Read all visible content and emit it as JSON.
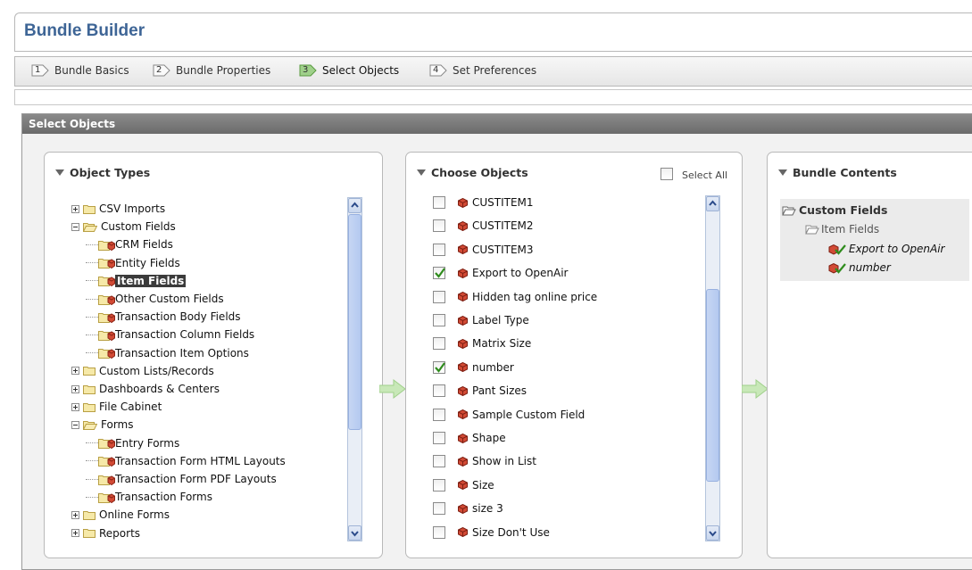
{
  "app": {
    "title": "Bundle Builder"
  },
  "steps": [
    {
      "num": "1",
      "label": "Bundle Basics",
      "active": false
    },
    {
      "num": "2",
      "label": "Bundle Properties",
      "active": false
    },
    {
      "num": "3",
      "label": "Select Objects",
      "active": true
    },
    {
      "num": "4",
      "label": "Set Preferences",
      "active": false
    }
  ],
  "section": {
    "title": "Select Objects"
  },
  "object_types": {
    "title": "Object Types",
    "tree": [
      {
        "label": "CSV Imports",
        "expander": "plus"
      },
      {
        "label": "Custom Fields",
        "expander": "minus"
      },
      {
        "label": "CRM Fields"
      },
      {
        "label": "Entity Fields"
      },
      {
        "label": "Item Fields",
        "selected": true
      },
      {
        "label": "Other Custom Fields"
      },
      {
        "label": "Transaction Body Fields"
      },
      {
        "label": "Transaction Column Fields"
      },
      {
        "label": "Transaction Item Options"
      },
      {
        "label": "Custom Lists/Records",
        "expander": "plus"
      },
      {
        "label": "Dashboards & Centers",
        "expander": "plus"
      },
      {
        "label": "File Cabinet",
        "expander": "plus"
      },
      {
        "label": "Forms",
        "expander": "minus"
      },
      {
        "label": "Entry Forms"
      },
      {
        "label": "Transaction Form HTML Layouts"
      },
      {
        "label": "Transaction Form PDF Layouts"
      },
      {
        "label": "Transaction Forms"
      },
      {
        "label": "Online Forms",
        "expander": "plus"
      },
      {
        "label": "Reports",
        "expander": "plus"
      }
    ]
  },
  "choose_objects": {
    "title": "Choose Objects",
    "select_all_label": "Select All",
    "items": [
      {
        "label": "CUSTITEM1",
        "checked": false
      },
      {
        "label": "CUSTITEM2",
        "checked": false
      },
      {
        "label": "CUSTITEM3",
        "checked": false
      },
      {
        "label": "Export to OpenAir",
        "checked": true
      },
      {
        "label": "Hidden tag online price",
        "checked": false
      },
      {
        "label": "Label Type",
        "checked": false
      },
      {
        "label": "Matrix Size",
        "checked": false
      },
      {
        "label": "number",
        "checked": true
      },
      {
        "label": "Pant Sizes",
        "checked": false
      },
      {
        "label": "Sample Custom Field",
        "checked": false
      },
      {
        "label": "Shape",
        "checked": false
      },
      {
        "label": "Show in List",
        "checked": false
      },
      {
        "label": "Size",
        "checked": false
      },
      {
        "label": "size 3",
        "checked": false
      },
      {
        "label": "Size Don't Use",
        "checked": false
      }
    ]
  },
  "bundle_contents": {
    "title": "Bundle Contents",
    "group": "Custom Fields",
    "subgroup": "Item Fields",
    "items": [
      "Export to OpenAir",
      "number"
    ]
  },
  "colors": {
    "title_blue": "#3e6596",
    "section_header": "#777777",
    "arrow_green": "#9fd08a",
    "check_green": "#2f8c1d",
    "cube_red": "#c0392b"
  }
}
